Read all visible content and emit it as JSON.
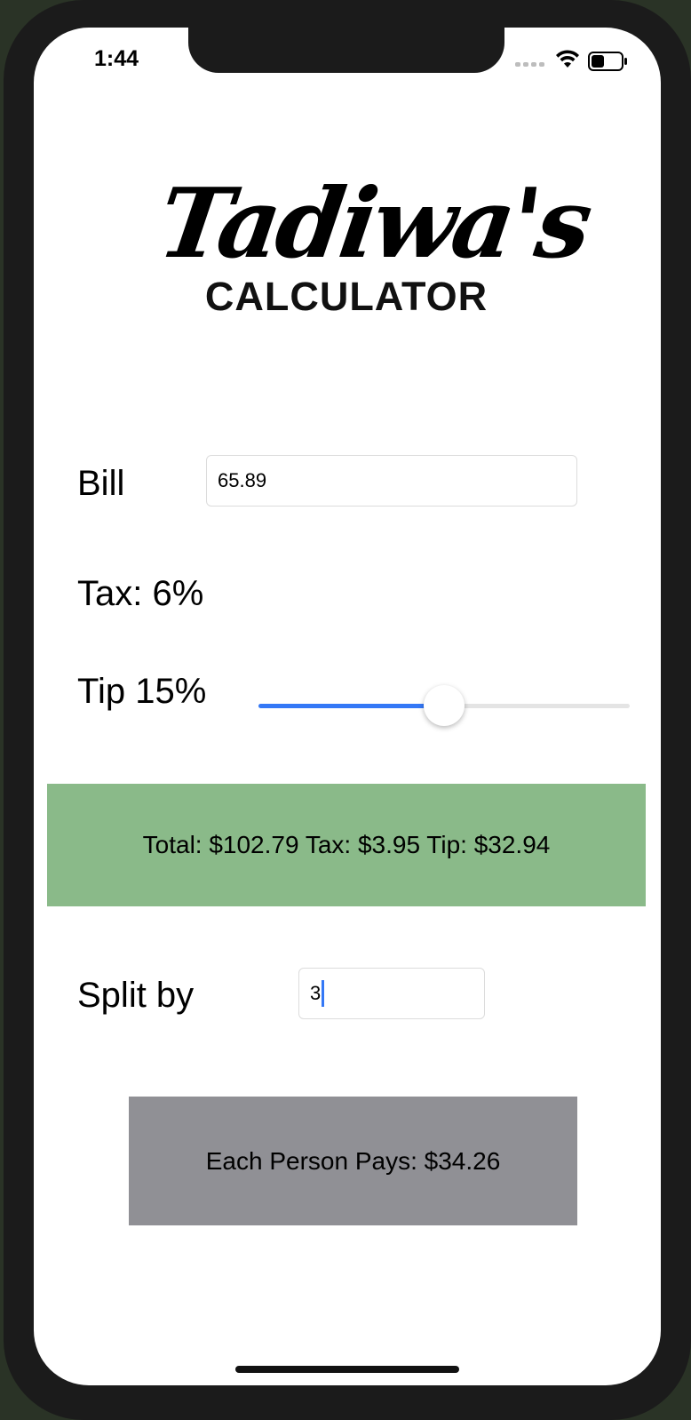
{
  "status_bar": {
    "time": "1:44"
  },
  "logo": {
    "script": "Tadiwa's",
    "subtitle": "CALCULATOR"
  },
  "bill": {
    "label": "Bill",
    "value": "65.89"
  },
  "tax": {
    "label": "Tax: 6%"
  },
  "tip": {
    "label": "Tip 15%",
    "slider_fraction": 0.5,
    "accent_color": "#3478f6"
  },
  "summary": {
    "text": "Total: $102.79 Tax: $3.95 Tip: $32.94",
    "bg_color": "#8aba89"
  },
  "split": {
    "label": "Split by",
    "value": "3"
  },
  "each": {
    "text": "Each Person Pays: $34.26",
    "bg_color": "#909095"
  }
}
